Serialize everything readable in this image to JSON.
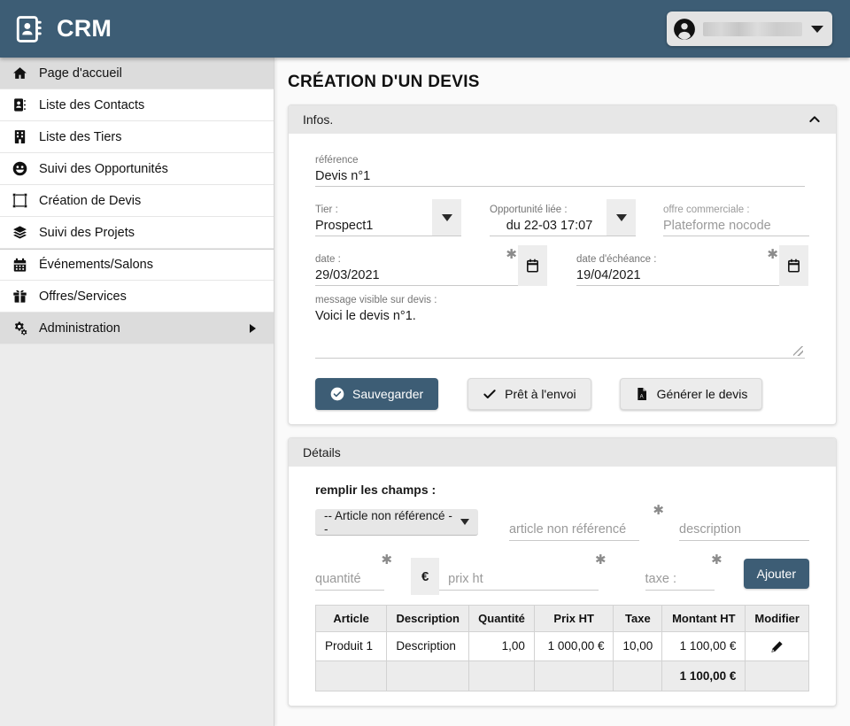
{
  "app": {
    "title": "CRM",
    "logo_icon": "address-book-icon",
    "accent_color": "#3d5d75"
  },
  "user_menu": {
    "avatar_icon": "user-circle-icon",
    "name": "",
    "caret_icon": "caret-down-icon"
  },
  "sidebar": {
    "items": [
      {
        "label": "Page d'accueil",
        "icon": "home-icon",
        "active": true,
        "has_submenu": false
      },
      {
        "label": "Liste des Contacts",
        "icon": "contact-card-icon",
        "active": false,
        "has_submenu": false
      },
      {
        "label": "Liste des Tiers",
        "icon": "building-icon",
        "active": false,
        "has_submenu": false
      },
      {
        "label": "Suivi des Opportunités",
        "icon": "smiley-icon",
        "active": false,
        "has_submenu": false
      },
      {
        "label": "Création de Devis",
        "icon": "object-group-icon",
        "active": false,
        "has_submenu": false
      },
      {
        "label": "Suivi des Projets",
        "icon": "layers-icon",
        "active": false,
        "has_submenu": false
      },
      {
        "label": "Événements/Salons",
        "icon": "calendar-icon",
        "active": false,
        "has_submenu": false
      },
      {
        "label": "Offres/Services",
        "icon": "gift-icon",
        "active": false,
        "has_submenu": false
      },
      {
        "label": "Administration",
        "icon": "cogs-icon",
        "active": true,
        "has_submenu": true
      }
    ]
  },
  "page": {
    "title": "CRÉATION D'UN DEVIS"
  },
  "infos_card": {
    "header": "Infos.",
    "collapse_icon": "chevron-up-icon",
    "reference": {
      "label": "référence",
      "value": "Devis n°1"
    },
    "tier": {
      "label": "Tier :",
      "value": "Prospect1",
      "dropdown_icon": "caret-down-icon"
    },
    "opportunity": {
      "label": "Opportunité liée :",
      "value": "du 22-03 17:07",
      "dropdown_icon": "caret-down-icon"
    },
    "offer": {
      "label": "offre commerciale :",
      "placeholder": "Plateforme nocode"
    },
    "date": {
      "label": "date :",
      "value": "29/03/2021",
      "required_mark": "✱",
      "calendar_icon": "calendar-icon"
    },
    "due_date": {
      "label": "date d'échéance :",
      "value": "19/04/2021",
      "required_mark": "✱",
      "calendar_icon": "calendar-icon"
    },
    "message": {
      "label": "message visible sur devis :",
      "value": "Voici le devis n°1."
    },
    "buttons": [
      {
        "label": "Sauvegarder",
        "icon": "check-circle-icon",
        "style": "primary"
      },
      {
        "label": "Prêt à l'envoi",
        "icon": "check-icon",
        "style": "default"
      },
      {
        "label": "Générer le devis",
        "icon": "file-pdf-icon",
        "style": "default"
      }
    ]
  },
  "details_card": {
    "header": "Détails",
    "fill_label": "remplir les champs :",
    "article_select": {
      "value": "-- Article non référencé --",
      "caret_icon": "caret-down-icon"
    },
    "article_input": {
      "placeholder": "article non référencé",
      "required_mark": "✱"
    },
    "description_input": {
      "placeholder": "description"
    },
    "quantity_input": {
      "placeholder": "quantité",
      "required_mark": "✱"
    },
    "price_input": {
      "prefix": "€",
      "placeholder": "prix ht",
      "required_mark": "✱"
    },
    "tax_input": {
      "placeholder": "taxe :",
      "required_mark": "✱"
    },
    "add_button": {
      "label": "Ajouter"
    },
    "table": {
      "columns": [
        "Article",
        "Description",
        "Quantité",
        "Prix HT",
        "Taxe",
        "Montant HT",
        "Modifier"
      ],
      "rows": [
        {
          "article": "Produit 1",
          "description": "Description",
          "quantity": "1,00",
          "price_ht": "1 000,00 €",
          "tax": "10,00",
          "amount_ht": "1 100,00 €",
          "edit_icon": "pencil-icon"
        }
      ],
      "total": {
        "amount_ht": "1 100,00 €"
      }
    }
  }
}
